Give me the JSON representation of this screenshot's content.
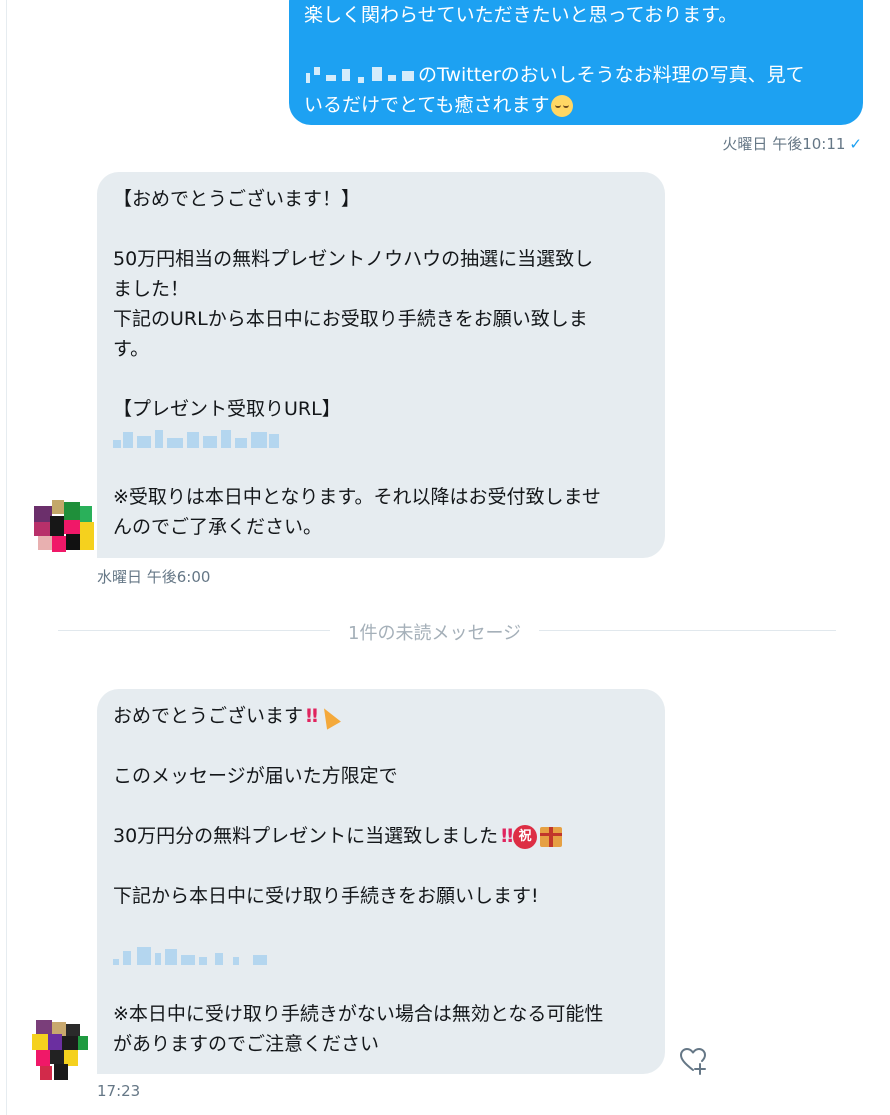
{
  "outgoing": {
    "lines": [
      "楽しく関わらせていただきたいと思っております。",
      "",
      "のTwitterのおいしそうなお料理の写真、見て",
      "いるだけでとても癒されます"
    ],
    "emoji": "relieved-face-icon",
    "timestamp": "火曜日 午後10:11",
    "read_mark": "✓"
  },
  "incoming1": {
    "lines": [
      "【おめでとうございます！】",
      "",
      "50万円相当の無料プレゼントノウハウの抽選に当選致し",
      "ました！",
      "下記のURLから本日中にお受取り手続きをお願い致しま",
      "す。",
      "",
      "【プレゼント受取りURL】",
      "",
      "※受取りは本日中となります。それ以降はお受付致しませ",
      "んのでご了承ください。"
    ],
    "timestamp": "水曜日 午後6:00"
  },
  "unread_divider": "1件の未読メッセージ",
  "incoming2": {
    "lines": [
      "おめでとうございます",
      "",
      "このメッセージが届いた方限定で",
      "",
      "30万円分の無料プレゼントに当選致しました",
      "",
      "下記から本日中に受け取り手続きをお願いします!",
      "",
      "",
      "※本日中に受け取り手続きがない場合は無効となる可能性",
      "がありますのでご注意ください"
    ],
    "congrats_glyph": "祝",
    "double_exclamation": "‼",
    "timestamp": "17:23"
  },
  "colors": {
    "outgoing_bubble": "#1da1f2",
    "incoming_bubble": "#e6ecf0",
    "meta_text": "#657786"
  }
}
